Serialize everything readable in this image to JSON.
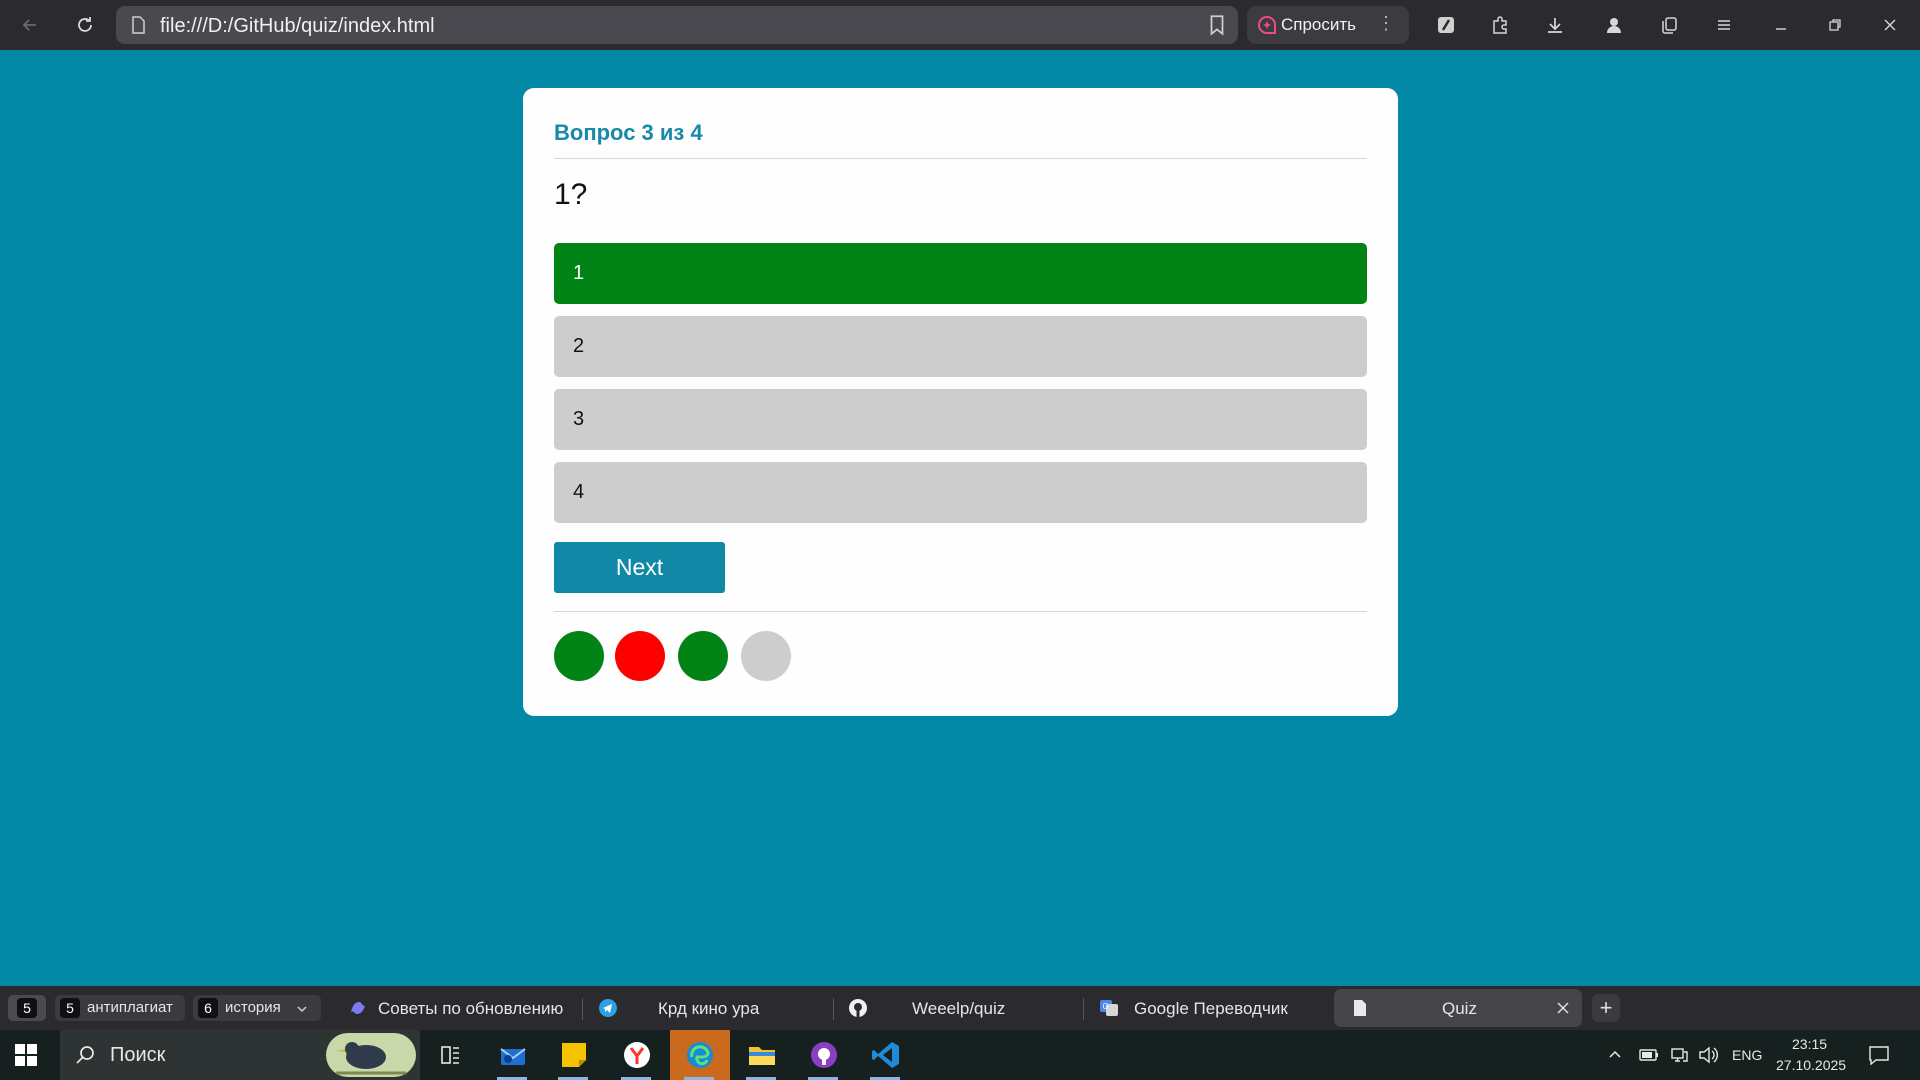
{
  "browser": {
    "url": "file:///D:/GitHub/quiz/index.html",
    "ask_label": "Спросить",
    "ask_dots": "⋮"
  },
  "quiz": {
    "header": "Вопрос 3 из 4",
    "question": "1?",
    "answers": [
      {
        "label": "1",
        "state": "correct"
      },
      {
        "label": "2",
        "state": "default"
      },
      {
        "label": "3",
        "state": "default"
      },
      {
        "label": "4",
        "state": "default"
      }
    ],
    "next_label": "Next",
    "progress": [
      "correct",
      "wrong",
      "correct",
      "pending"
    ],
    "colors": {
      "accent": "#1188a6",
      "correct": "#018316",
      "wrong": "#ff0000",
      "pending": "#cdcdcd",
      "background": "#0389a6"
    }
  },
  "tabs": {
    "workspace_count": "5",
    "groups": [
      {
        "num": "5",
        "label": "антиплагиат"
      },
      {
        "num": "6",
        "label": "история"
      }
    ],
    "items": [
      {
        "label": "Советы по обновлению н",
        "icon": "copilot-icon"
      },
      {
        "label": "Крд кино ура",
        "icon": "telegram-icon"
      },
      {
        "label": "Weeelp/quiz",
        "icon": "github-icon"
      },
      {
        "label": "Google Переводчик",
        "icon": "google-translate-icon"
      },
      {
        "label": "Quiz",
        "icon": "page-icon",
        "active": true
      }
    ],
    "new_tab": "+"
  },
  "taskbar": {
    "search_placeholder": "Поиск",
    "lang": "ENG",
    "time": "23:15",
    "date": "27.10.2025"
  }
}
